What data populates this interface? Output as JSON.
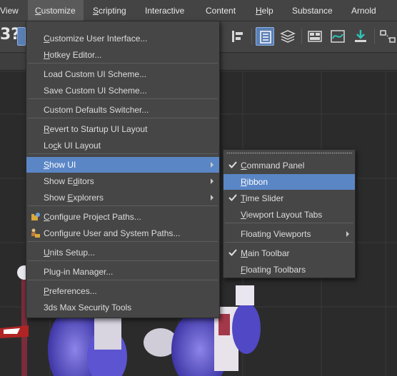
{
  "menubar": {
    "items": [
      {
        "label": "View",
        "underline_index": -1
      },
      {
        "label": "Customize",
        "underline_index": 0
      },
      {
        "label": "Scripting",
        "underline_index": 0
      },
      {
        "label": "Interactive",
        "underline_index": -1
      },
      {
        "label": "Content",
        "underline_index": -1
      },
      {
        "label": "Help",
        "underline_index": 0
      },
      {
        "label": "Substance",
        "underline_index": -1
      },
      {
        "label": "Arnold",
        "underline_index": -1
      }
    ],
    "active": "Customize"
  },
  "toolbar": {
    "partial_label": "3?"
  },
  "customize_menu": {
    "items": [
      {
        "label": "Customize User Interface...",
        "underline_index": 0,
        "submenu": false,
        "highlighted": false,
        "icon": null
      },
      {
        "label": "Hotkey Editor...",
        "underline_index": 0,
        "submenu": false,
        "highlighted": false,
        "icon": null
      },
      {
        "label": "Load Custom UI Scheme...",
        "underline_index": -1,
        "submenu": false,
        "highlighted": false,
        "icon": null
      },
      {
        "label": "Save Custom UI Scheme...",
        "underline_index": -1,
        "submenu": false,
        "highlighted": false,
        "icon": null
      },
      {
        "label": "Custom Defaults Switcher...",
        "underline_index": -1,
        "submenu": false,
        "highlighted": false,
        "icon": null
      },
      {
        "label": "Revert to Startup UI Layout",
        "underline_index": 0,
        "submenu": false,
        "highlighted": false,
        "icon": null
      },
      {
        "label": "Lock UI Layout",
        "underline_index": 2,
        "submenu": false,
        "highlighted": false,
        "icon": null
      },
      {
        "label": "Show UI",
        "underline_index": 0,
        "submenu": true,
        "highlighted": true,
        "icon": null
      },
      {
        "label": "Show Editors",
        "underline_index": 6,
        "submenu": true,
        "highlighted": false,
        "icon": null
      },
      {
        "label": "Show Explorers",
        "underline_index": 5,
        "submenu": true,
        "highlighted": false,
        "icon": null
      },
      {
        "label": "Configure Project Paths...",
        "underline_index": 0,
        "submenu": false,
        "highlighted": false,
        "icon": "folder-paths-icon"
      },
      {
        "label": "Configure User and System Paths...",
        "underline_index": -1,
        "submenu": false,
        "highlighted": false,
        "icon": "user-folder-paths-icon"
      },
      {
        "label": "Units Setup...",
        "underline_index": 0,
        "submenu": false,
        "highlighted": false,
        "icon": null
      },
      {
        "label": "Plug-in Manager...",
        "underline_index": -1,
        "submenu": false,
        "highlighted": false,
        "icon": null
      },
      {
        "label": "Preferences...",
        "underline_index": 0,
        "submenu": false,
        "highlighted": false,
        "icon": null
      },
      {
        "label": "3ds Max Security Tools",
        "underline_index": -1,
        "submenu": false,
        "highlighted": false,
        "icon": null
      }
    ]
  },
  "show_ui_submenu": {
    "items": [
      {
        "label": "Command Panel",
        "underline_index": 0,
        "checked": true,
        "submenu": false,
        "highlighted": false
      },
      {
        "label": "Ribbon",
        "underline_index": 0,
        "checked": false,
        "submenu": false,
        "highlighted": true
      },
      {
        "label": "Time Slider",
        "underline_index": 0,
        "checked": true,
        "submenu": false,
        "highlighted": false
      },
      {
        "label": "Viewport Layout Tabs",
        "underline_index": 0,
        "checked": false,
        "submenu": false,
        "highlighted": false
      },
      {
        "label": "Floating Viewports",
        "underline_index": -1,
        "checked": false,
        "submenu": true,
        "highlighted": false
      },
      {
        "label": "Main Toolbar",
        "underline_index": 0,
        "checked": true,
        "submenu": false,
        "highlighted": false
      },
      {
        "label": "Floating Toolbars",
        "underline_index": 0,
        "checked": false,
        "submenu": false,
        "highlighted": false
      }
    ]
  },
  "colors": {
    "menu_bg": "#464646",
    "highlight": "#5a86c6",
    "menubar_bg": "#444444",
    "viewport_bg": "#2b2b2b",
    "accent_teal": "#2ec4b6"
  }
}
